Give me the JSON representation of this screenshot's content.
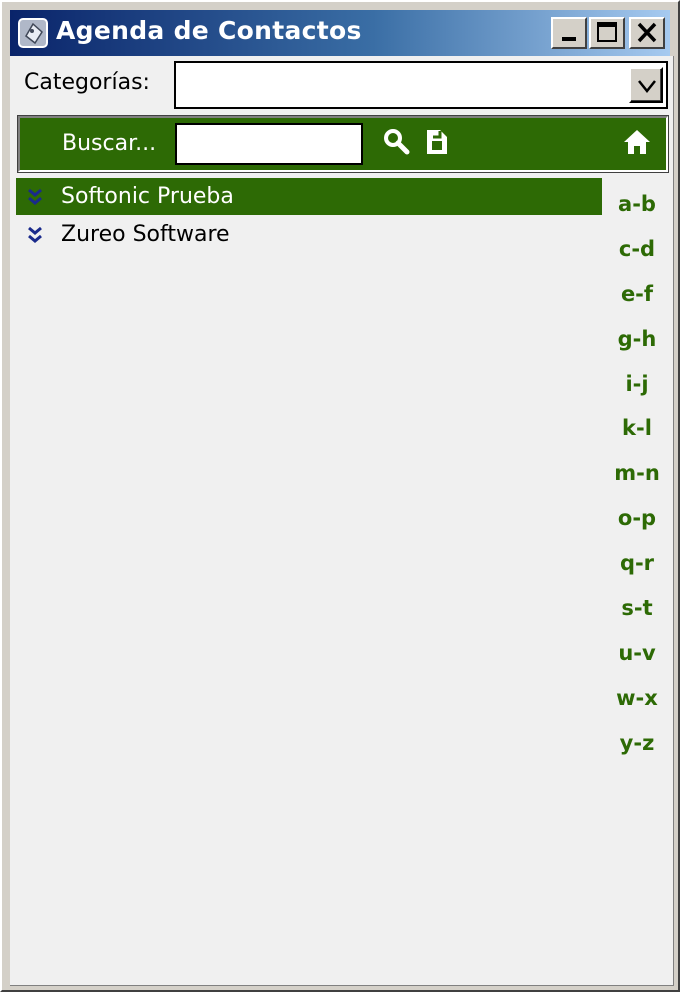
{
  "window": {
    "title": "Agenda de Contactos"
  },
  "categories": {
    "label": "Categorías:",
    "selected": ""
  },
  "search": {
    "label": "Buscar...",
    "value": ""
  },
  "contacts": [
    {
      "name": "Softonic Prueba",
      "selected": true
    },
    {
      "name": "Zureo Software",
      "selected": false
    }
  ],
  "alphabet": [
    "a-b",
    "c-d",
    "e-f",
    "g-h",
    "i-j",
    "k-l",
    "m-n",
    "o-p",
    "q-r",
    "s-t",
    "u-v",
    "w-x",
    "y-z"
  ],
  "icons": {
    "app": "contact-card-icon",
    "search": "magnifier-icon",
    "new": "document-icon",
    "home": "home-icon",
    "expand": "double-chevron-down-icon"
  },
  "colors": {
    "accent_green": "#2d6a05",
    "titlebar_start": "#0a246a",
    "titlebar_end": "#a6caf0",
    "client_bg": "#f0f0f0"
  }
}
